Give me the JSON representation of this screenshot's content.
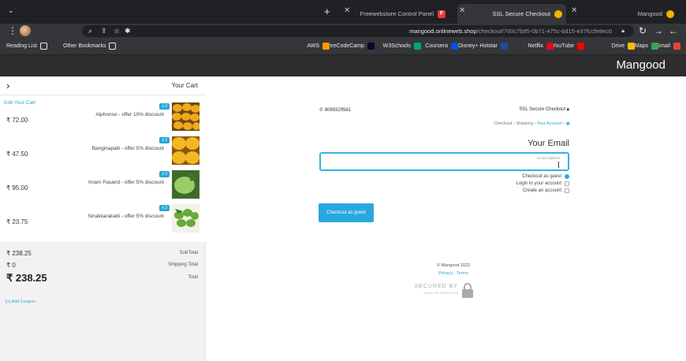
{
  "browser": {
    "tabs": [
      {
        "title": "Mangood",
        "icon": "mangood-favicon"
      },
      {
        "title": "SSL Secure Checkout",
        "icon": "mangood-favicon"
      },
      {
        "title": "Freewebstore Control Panel",
        "icon": "freewebstore-favicon"
      }
    ],
    "new_tab_label": "+",
    "url_host": "mangood.onlineweb.shop",
    "url_path": "/checkout/760c7b95-0b71-475c-bd15-e37fccfe8ec0",
    "bookmarks": [
      {
        "label": "Gmail",
        "color": "#ea4335"
      },
      {
        "label": "Maps",
        "color": "#34a853"
      },
      {
        "label": "Drive",
        "color": "#fbbc04"
      },
      {
        "label": "YouTube",
        "color": "#ff0000"
      },
      {
        "label": "Netflix",
        "color": "#e50914"
      },
      {
        "label": "Disney+ Hotstar",
        "color": "#1f4ba5"
      },
      {
        "label": "Coursera",
        "color": "#0056d2"
      },
      {
        "label": "W3Schools",
        "color": "#04aa6d"
      },
      {
        "label": "FreeCodeCamp",
        "color": "#0a0a23"
      },
      {
        "label": "AWS",
        "color": "#ff9900"
      }
    ],
    "other_bookmarks": "Other Bookmarks",
    "reading_list": "Reading List"
  },
  "site": {
    "brand": "Mangood"
  },
  "cart": {
    "title": "Your Cart",
    "edit_link": "Edit Your Cart",
    "items": [
      {
        "name": "Alphonso - offer 10% discount",
        "qty": "x 2",
        "price": "₹ 72.00"
      },
      {
        "name": "Banginapalli - offer 5% discount",
        "qty": "x 2",
        "price": "₹ 47.50"
      },
      {
        "name": "Imam Pasand - offer 5% discount",
        "qty": "x 2",
        "price": "₹ 95.00"
      },
      {
        "name": "Sinakkarakatti - offer 5% discount",
        "qty": "x 2",
        "price": "₹ 23.75"
      }
    ],
    "subtotal_label": "SubTotal",
    "subtotal_value": "₹ 238.25",
    "shipping_label": "Shipping Total",
    "shipping_value": "₹ 0",
    "total_label": "Total",
    "total_value": "₹ 238.25",
    "coupon_link": "[+] Add Coupon"
  },
  "checkout": {
    "secure_label": "SSL Secure Checkout",
    "phone": "8088329561",
    "breadcrumbs": [
      "Your Account",
      "Shipping",
      "Checkout"
    ],
    "email_title": "Your Email",
    "email_placeholder": "Email Address",
    "email_value": "",
    "options": [
      {
        "label": "Checkout as guest",
        "selected": true
      },
      {
        "label": "Login to your account",
        "selected": false
      },
      {
        "label": "Create an account",
        "selected": false
      }
    ],
    "continue_button": "Checkout as guest"
  },
  "footer": {
    "copyright": "© Mangood 2022",
    "terms": "Terms",
    "privacy": "Privacy",
    "secured_by": "SECURED BY",
    "secured_sub": "256-BIT SSL ENCRYPTION"
  },
  "colors": {
    "accent": "#2aa7d6",
    "header": "#2d2d2d",
    "chrome": "#35363a"
  }
}
